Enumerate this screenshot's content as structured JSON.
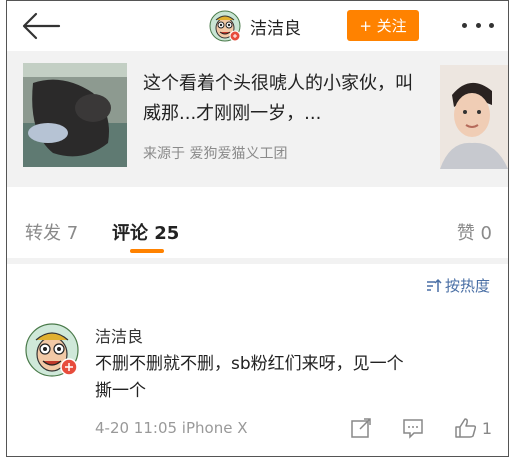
{
  "header": {
    "author_name": "洁洁良",
    "follow_label": "+ 关注"
  },
  "repost_card": {
    "text": "这个看着个头很唬人的小家伙，叫威那...才刚刚一岁，...",
    "source": "来源于 爱狗爱猫义工团"
  },
  "tabs": [
    {
      "label": "转发 7"
    },
    {
      "label": "评论 25"
    },
    {
      "label": "赞 0"
    }
  ],
  "sort_label": "按热度",
  "comment": {
    "name": "洁洁良",
    "text": "不删不删就不删，sb粉红们来呀，见一个撕一个",
    "meta": "4-20 11:05  iPhone X",
    "like_count": "1"
  },
  "colors": {
    "accent": "#ff8200",
    "link": "#4a6fa5"
  }
}
